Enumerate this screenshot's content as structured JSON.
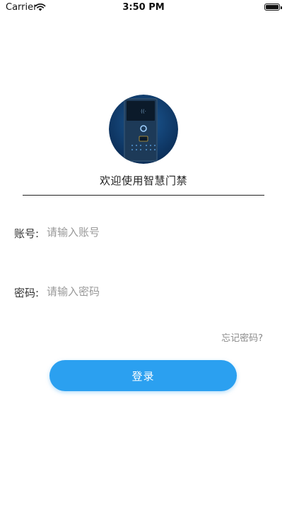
{
  "status_bar": {
    "carrier": "Carrier",
    "time": "3:50 PM"
  },
  "header": {
    "welcome": "欢迎使用智慧门禁"
  },
  "form": {
    "account_label": "账号:",
    "account_placeholder": "请输入账号",
    "password_label": "密码:",
    "password_placeholder": "请输入密码",
    "forgot_label": "忘记密码?",
    "login_label": "登录"
  },
  "colors": {
    "accent": "#2ba0f0",
    "logo_background": "#0e3766"
  },
  "icons": [
    "wifi-icon",
    "battery-icon",
    "access-control-device-logo"
  ]
}
